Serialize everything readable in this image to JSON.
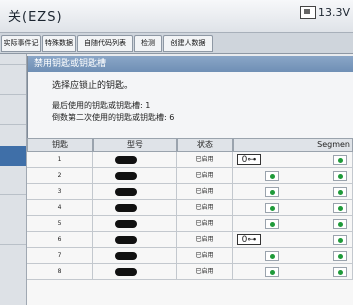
{
  "titlebar": {
    "title": "关(EZS)",
    "voltage": "13.3V"
  },
  "tabs": [
    {
      "label": "实际事件记录"
    },
    {
      "label": "特殊数据"
    },
    {
      "label": "自随代码列表"
    },
    {
      "label": "检测"
    },
    {
      "label": "创建人数据"
    }
  ],
  "dialog": {
    "title": "禁用钥匙或钥匙槽",
    "prompt": "选择应锁止的钥匙。",
    "info_last": "最后使用的钥匙或钥匙槽: 1",
    "info_second_last": "倒数第二次使用的钥匙或钥匙槽: 6"
  },
  "table": {
    "headers": {
      "key": "钥匙",
      "model": "型号",
      "status": "状态",
      "segment": "Segmen"
    },
    "rows": [
      {
        "key": "1",
        "status": "已启用",
        "key_icon": true,
        "seg": [
          false,
          true
        ]
      },
      {
        "key": "2",
        "status": "已启用",
        "key_icon": false,
        "seg": [
          true,
          true
        ]
      },
      {
        "key": "3",
        "status": "已启用",
        "key_icon": false,
        "seg": [
          true,
          true
        ]
      },
      {
        "key": "4",
        "status": "已启用",
        "key_icon": false,
        "seg": [
          true,
          true
        ]
      },
      {
        "key": "5",
        "status": "已启用",
        "key_icon": false,
        "seg": [
          true,
          true
        ]
      },
      {
        "key": "6",
        "status": "已启用",
        "key_icon": true,
        "seg": [
          false,
          true
        ]
      },
      {
        "key": "7",
        "status": "已启用",
        "key_icon": false,
        "seg": [
          true,
          true
        ]
      },
      {
        "key": "8",
        "status": "已启用",
        "key_icon": false,
        "seg": [
          true,
          true
        ]
      }
    ],
    "key_icon_glyph": "0⊶"
  },
  "colors": {
    "title_bar_dialog": "#7a98bd",
    "status_dot": "#1f9a3a",
    "left_selected": "#3f6fa8"
  }
}
